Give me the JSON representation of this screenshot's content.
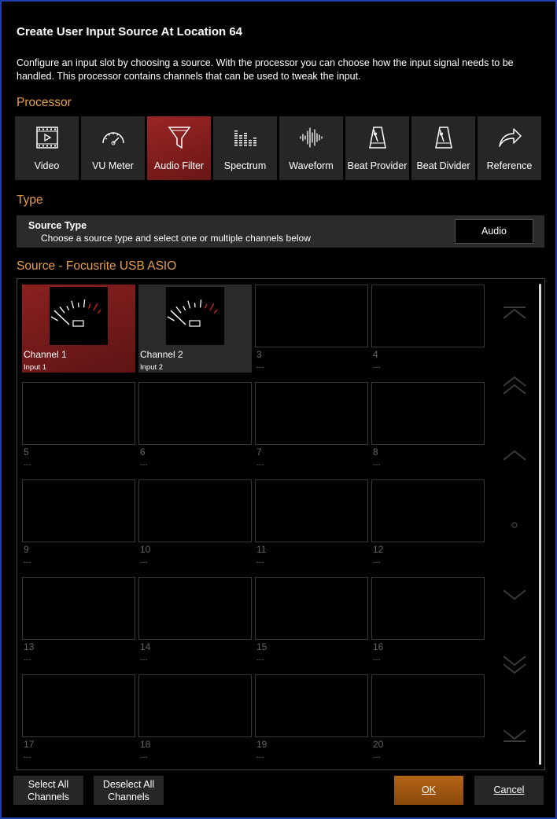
{
  "dialog": {
    "title": "Create User Input Source At Location 64",
    "description": "Configure an input slot by choosing a source. With the processor you can choose how the input signal needs to be handled. This processor contains channels that can be used to tweak the input."
  },
  "processor": {
    "section_label": "Processor",
    "selected": "Audio Filter",
    "items": [
      {
        "label": "Video",
        "icon": "film-icon"
      },
      {
        "label": "VU Meter",
        "icon": "gauge-icon"
      },
      {
        "label": "Audio Filter",
        "icon": "funnel-icon"
      },
      {
        "label": "Spectrum",
        "icon": "spectrum-bars-icon"
      },
      {
        "label": "Waveform",
        "icon": "waveform-icon"
      },
      {
        "label": "Beat Provider",
        "icon": "metronome-icon"
      },
      {
        "label": "Beat Divider",
        "icon": "metronome-icon"
      },
      {
        "label": "Reference",
        "icon": "share-arrow-icon"
      }
    ]
  },
  "type": {
    "section_label": "Type",
    "heading": "Source Type",
    "hint": "Choose a source type and select one or multiple channels below",
    "value": "Audio"
  },
  "source": {
    "section_label": "Source - Focusrite USB ASIO",
    "channels": [
      {
        "name": "Channel 1",
        "sub": "Input 1",
        "state": "selected"
      },
      {
        "name": "Channel 2",
        "sub": "Input 2",
        "state": "available"
      },
      {
        "name": "3",
        "sub": "---",
        "state": "empty"
      },
      {
        "name": "4",
        "sub": "---",
        "state": "empty"
      },
      {
        "name": "5",
        "sub": "---",
        "state": "empty"
      },
      {
        "name": "6",
        "sub": "---",
        "state": "empty"
      },
      {
        "name": "7",
        "sub": "---",
        "state": "empty"
      },
      {
        "name": "8",
        "sub": "---",
        "state": "empty"
      },
      {
        "name": "9",
        "sub": "---",
        "state": "empty"
      },
      {
        "name": "10",
        "sub": "---",
        "state": "empty"
      },
      {
        "name": "11",
        "sub": "---",
        "state": "empty"
      },
      {
        "name": "12",
        "sub": "---",
        "state": "empty"
      },
      {
        "name": "13",
        "sub": "---",
        "state": "empty"
      },
      {
        "name": "14",
        "sub": "---",
        "state": "empty"
      },
      {
        "name": "15",
        "sub": "---",
        "state": "empty"
      },
      {
        "name": "16",
        "sub": "---",
        "state": "empty"
      },
      {
        "name": "17",
        "sub": "---",
        "state": "empty"
      },
      {
        "name": "18",
        "sub": "---",
        "state": "empty"
      },
      {
        "name": "19",
        "sub": "---",
        "state": "empty"
      },
      {
        "name": "20",
        "sub": "---",
        "state": "empty"
      }
    ],
    "nav_icons": [
      "scroll-top-icon",
      "page-up-icon",
      "line-up-icon",
      "center-dot-icon",
      "line-down-icon",
      "page-down-icon",
      "scroll-bottom-icon"
    ]
  },
  "footer": {
    "select_all": "Select All Channels",
    "deselect_all": "Deselect All Channels",
    "ok": "OK",
    "cancel": "Cancel"
  },
  "colors": {
    "accent_orange": "#e8a04a",
    "selected_red": "#8a2020",
    "ok_orange": "#a85c12",
    "frame_blue": "#1c3fa8"
  }
}
